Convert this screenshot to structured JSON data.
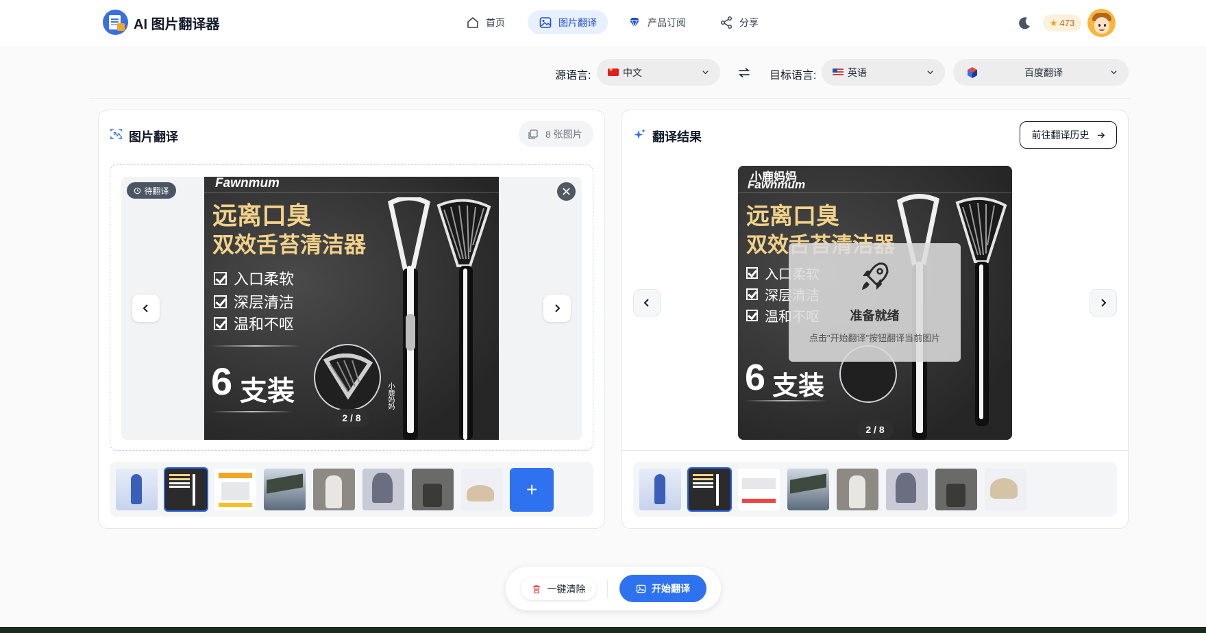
{
  "app": {
    "title": "AI 图片翻译器"
  },
  "nav": [
    {
      "label": "首页",
      "icon": "home-icon",
      "active": false
    },
    {
      "label": "图片翻译",
      "icon": "image-translate-icon",
      "active": true
    },
    {
      "label": "产品订阅",
      "icon": "diamond-icon",
      "active": false
    },
    {
      "label": "分享",
      "icon": "share-icon",
      "active": false
    }
  ],
  "user": {
    "points": "473",
    "theme_icon": "moon-icon"
  },
  "language": {
    "source_label": "源语言:",
    "source_value": "中文",
    "target_label": "目标语言:",
    "target_value": "英语",
    "engine_value": "百度翻译"
  },
  "left_panel": {
    "title": "图片翻译",
    "count": "8 张图片",
    "status_badge": "待翻译",
    "pager": "2 / 8",
    "add_label": "+"
  },
  "right_panel": {
    "title": "翻译结果",
    "history_button": "前往翻译历史",
    "ready_title": "准备就绪",
    "ready_hint": "点击\"开始翻译\"按钮翻译当前图片",
    "pager": "2 / 8"
  },
  "product_image": {
    "brand": "Fawnmum",
    "brand_cn": "小鹿妈妈",
    "headline_1": "远离口臭",
    "headline_2": "双效舌苔清洁器",
    "features": [
      "入口柔软",
      "深层清洁",
      "温和不呕"
    ],
    "pack_number": "6",
    "pack_text": "支装",
    "handle_text": "小鹿妈妈"
  },
  "actions": {
    "clear": "一键清除",
    "start": "开始翻译"
  },
  "colors": {
    "accent": "#2f72f0",
    "nav_active_bg": "#e8f0fd",
    "points_bg": "#fdf0dc",
    "headline": "#f3d28a"
  }
}
